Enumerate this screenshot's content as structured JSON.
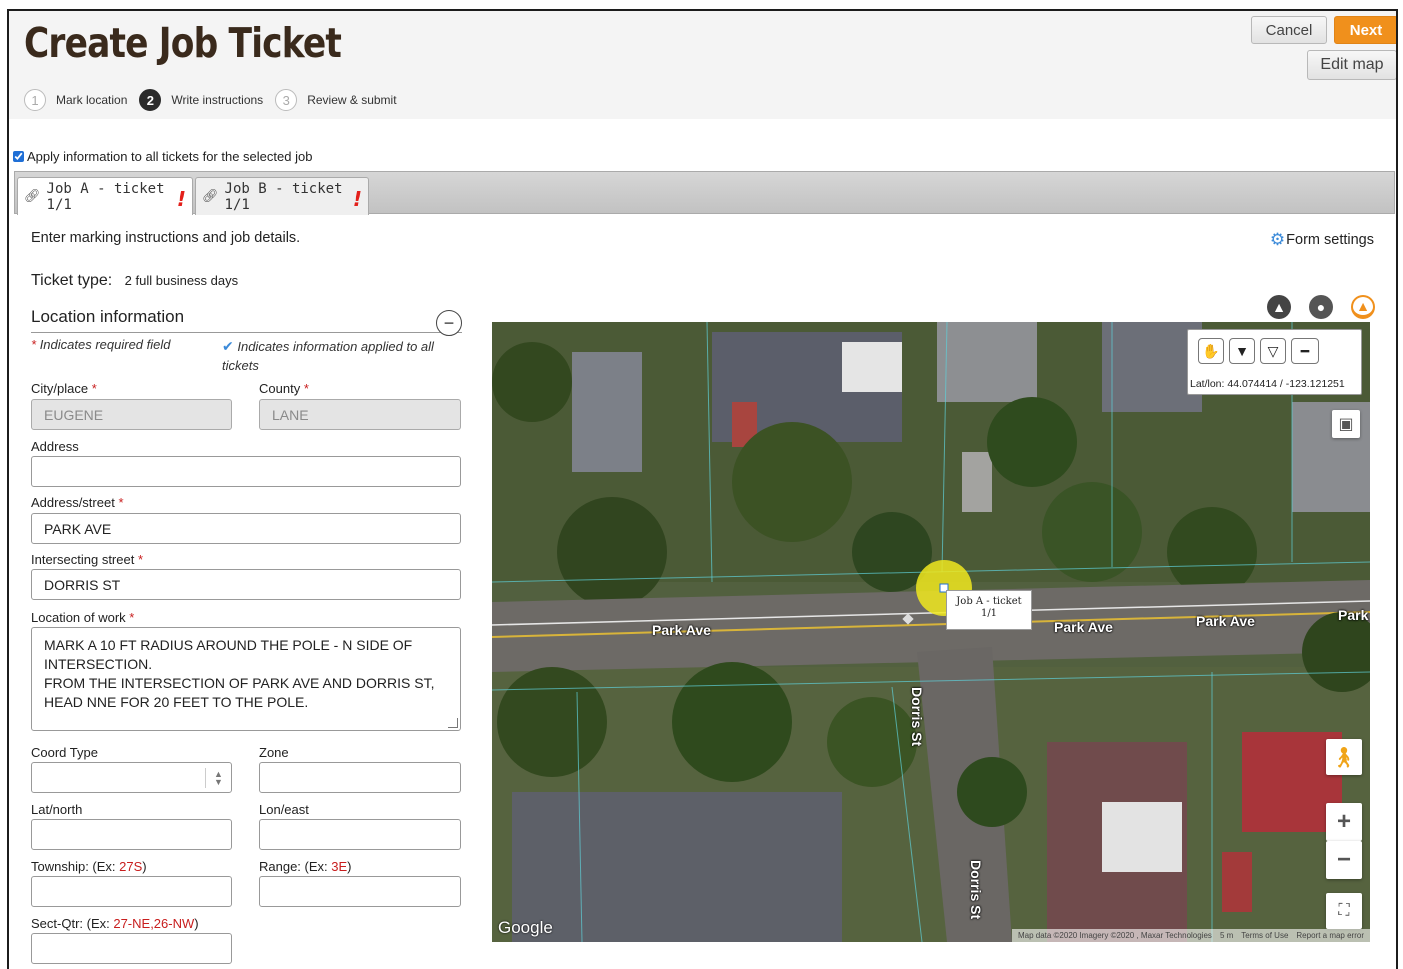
{
  "header": {
    "title": "Create Job Ticket",
    "steps": [
      {
        "num": "1",
        "label": "Mark location"
      },
      {
        "num": "2",
        "label": "Write instructions"
      },
      {
        "num": "3",
        "label": "Review & submit"
      }
    ],
    "cancel_label": "Cancel",
    "next_label": "Next",
    "edit_map_label": "Edit map"
  },
  "apply_all": {
    "label": "Apply information to all tickets for the selected job",
    "checked": true
  },
  "tabs": [
    {
      "label": "Job A - ticket 1/1",
      "warning": "!"
    },
    {
      "label": "Job B - ticket 1/1",
      "warning": "!"
    }
  ],
  "instructions": "Enter marking instructions and job details.",
  "form_settings_label": "Form settings",
  "ticket_type": {
    "label": "Ticket type:",
    "value": "2 full business days"
  },
  "location": {
    "heading": "Location information",
    "required_note": "Indicates required field",
    "applied_note": "Indicates information applied to all tickets",
    "star": "*",
    "fields": {
      "city": {
        "label": "City/place",
        "value": "EUGENE"
      },
      "county": {
        "label": "County",
        "value": "LANE"
      },
      "address": {
        "label": "Address",
        "value": ""
      },
      "street": {
        "label": "Address/street",
        "value": "PARK AVE"
      },
      "intersecting": {
        "label": "Intersecting street",
        "value": "DORRIS ST"
      },
      "work": {
        "label": "Location of work",
        "value": "MARK A 10 FT RADIUS AROUND THE POLE - N SIDE OF INTERSECTION.\nFROM THE INTERSECTION OF PARK AVE AND DORRIS ST, HEAD NNE FOR 20 FEET TO THE POLE."
      },
      "coord_type": {
        "label": "Coord Type",
        "value": ""
      },
      "zone": {
        "label": "Zone",
        "value": ""
      },
      "lat": {
        "label": "Lat/north",
        "value": ""
      },
      "lon": {
        "label": "Lon/east",
        "value": ""
      },
      "township": {
        "label": "Township: (Ex: ",
        "example": "27S",
        "close": ")",
        "value": ""
      },
      "range": {
        "label": "Range: (Ex: ",
        "example": "3E",
        "close": ")",
        "value": ""
      },
      "sectqtr": {
        "label": "Sect-Qtr: (Ex: ",
        "example": "27-NE,26-NW",
        "close": ")",
        "value": ""
      }
    }
  },
  "map": {
    "latlon": "Lat/lon: 44.074414 / -123.121251",
    "popup": "Job A - ticket 1/1",
    "streets": [
      "Park Ave",
      "Park Ave",
      "Park Ave",
      "Park Ave",
      "Park",
      "Dorris St",
      "Dorris St"
    ],
    "google": "Google",
    "attribution": [
      "Map data ©2020 Imagery ©2020 , Maxar Technologies",
      "5 m",
      "Terms of Use",
      "Report a map error"
    ],
    "zoom_in": "+",
    "zoom_out": "−",
    "tool_icons": [
      "hand-icon",
      "pin-icon",
      "pin-outline-icon",
      "ruler-icon"
    ],
    "layer_icons": [
      "layers-person-icon",
      "globe-icon",
      "streetview-icon"
    ],
    "marker_color": "#f0e81e"
  },
  "colors": {
    "accent": "#f0901c",
    "required": "#c81e1e",
    "link_blue": "#3b8ad9",
    "title": "#3a2a1c"
  }
}
